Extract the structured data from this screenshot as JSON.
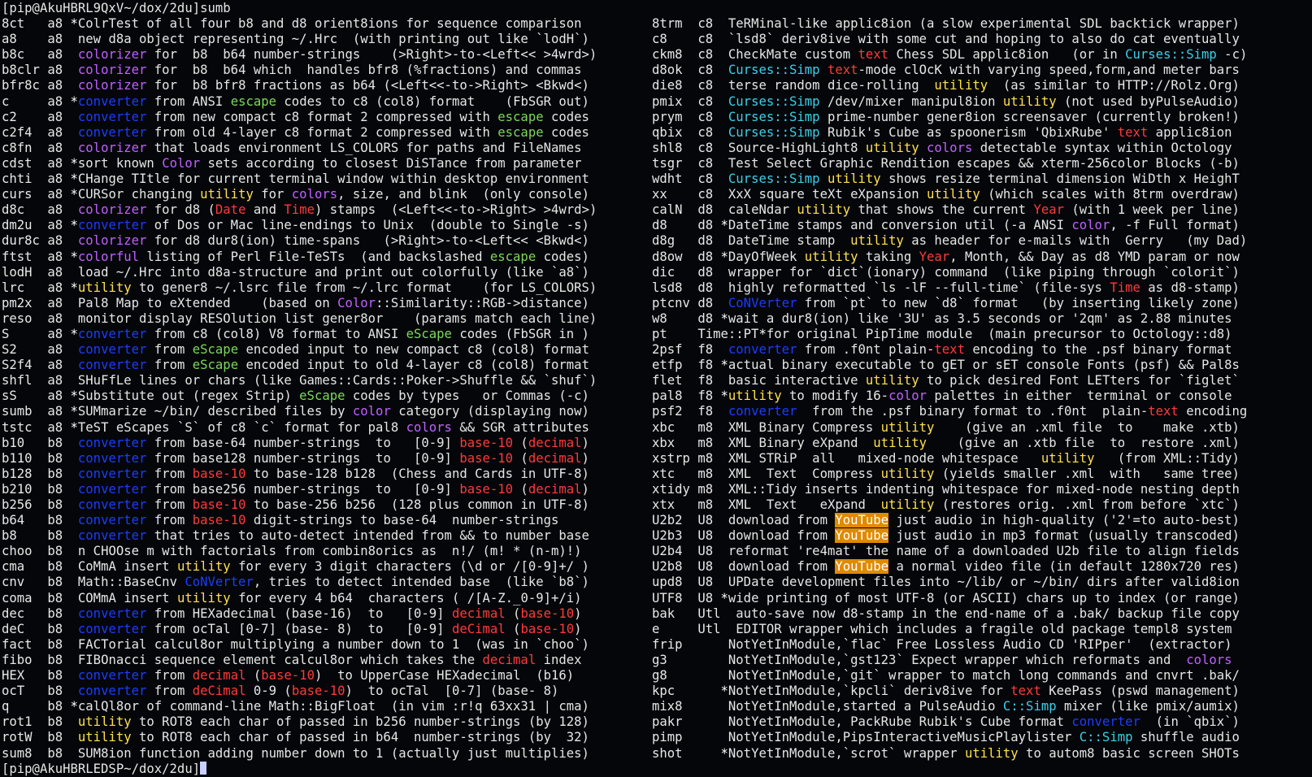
{
  "terminal": {
    "prompt_top": "[pip@AkuHBRL9QxV~/dox/2du]sumb",
    "prompt_bottom": "[pip@AkuHBRLEDSP~/dox/2du]"
  },
  "left_rows": [
    {
      "name": "8ct",
      "cat": "a8",
      "star": "*",
      "desc": "ColrTest of all four b8 and d8 orient8ions for sequence comparison"
    },
    {
      "name": "a8",
      "cat": "a8",
      "star": " ",
      "desc": "new d8a object representing ~/.Hrc  (with printing out like `lodH`)"
    },
    {
      "name": "b8c",
      "cat": "a8",
      "star": " ",
      "desc": "colorizer for  b8  b64 number-strings    (>Right>-to-<Left<< >4wrd>)"
    },
    {
      "name": "b8clr",
      "cat": "a8",
      "star": " ",
      "desc": "colorizer for  b8  b64 which  handles bfr8 (%fractions) and commas"
    },
    {
      "name": "bfr8c",
      "cat": "a8",
      "star": " ",
      "desc": "colorizer for  b8 bfr8 fractions as b64 (<Left<<-to->Right> <Bkwd<)"
    },
    {
      "name": "c",
      "cat": "a8",
      "star": "*",
      "desc": "converter from ANSI escape codes to c8 (col8) format    (FbSGR out)"
    },
    {
      "name": "c2",
      "cat": "a8",
      "star": " ",
      "desc": "converter from new compact c8 format 2 compressed with escape codes"
    },
    {
      "name": "c2f4",
      "cat": "a8",
      "star": " ",
      "desc": "converter from old 4-layer c8 format 2 compressed with escape codes"
    },
    {
      "name": "c8fn",
      "cat": "a8",
      "star": " ",
      "desc": "colorizer that loads environment LS_COLORS for paths and FileNames"
    },
    {
      "name": "cdst",
      "cat": "a8",
      "star": "*",
      "desc": "sort known Color sets according to closest DiSTance from parameter"
    },
    {
      "name": "chti",
      "cat": "a8",
      "star": "*",
      "desc": "CHange TItle for current terminal window within desktop environment"
    },
    {
      "name": "curs",
      "cat": "a8",
      "star": "*",
      "desc": "CURSor changing utility for colors, size, and blink  (only console)"
    },
    {
      "name": "d8c",
      "cat": "a8",
      "star": " ",
      "desc": "colorizer for d8 (Date and Time) stamps  (<Left<<-to->Right> >4wrd>)"
    },
    {
      "name": "dm2u",
      "cat": "a8",
      "star": "*",
      "desc": "converter of Dos or Mac line-endings to Unix  (double to Single -s)"
    },
    {
      "name": "dur8c",
      "cat": "a8",
      "star": " ",
      "desc": "colorizer for d8 dur8(ion) time-spans   (>Right>-to-<Left<< <Bkwd<)"
    },
    {
      "name": "ftst",
      "cat": "a8",
      "star": "*",
      "desc": "colorful listing of Perl File-TeSTs  (and backslashed escape codes)"
    },
    {
      "name": "lodH",
      "cat": "a8",
      "star": " ",
      "desc": "load ~/.Hrc into d8a-structure and print out colorfully (like `a8`)"
    },
    {
      "name": "lrc",
      "cat": "a8",
      "star": "*",
      "desc": "utility to gener8 ~/.lsrc file from ~/.lrc format    (for LS_COLORS)"
    },
    {
      "name": "pm2x",
      "cat": "a8",
      "star": " ",
      "desc": "Pal8 Map to eXtended    (based on Color::Similarity::RGB->distance)"
    },
    {
      "name": "reso",
      "cat": "a8",
      "star": " ",
      "desc": "monitor display RESOlution list gener8or    (params match each line)"
    },
    {
      "name": "S",
      "cat": "a8",
      "star": "*",
      "desc": "converter from c8 (col8) V8 format to ANSI eScape codes (FbSGR in )"
    },
    {
      "name": "S2",
      "cat": "a8",
      "star": " ",
      "desc": "converter from eScape encoded input to new compact c8 (col8) format"
    },
    {
      "name": "S2f4",
      "cat": "a8",
      "star": " ",
      "desc": "converter from eScape encoded input to old 4-layer c8 (col8) format"
    },
    {
      "name": "shfl",
      "cat": "a8",
      "star": " ",
      "desc": "SHuFfLe lines or chars (like Games::Cards::Poker->Shuffle && `shuf`)"
    },
    {
      "name": "sS",
      "cat": "a8",
      "star": "*",
      "desc": "Substitute out (regex Strip) eScape codes by types   or Commas (-c)"
    },
    {
      "name": "sumb",
      "cat": "a8",
      "star": "*",
      "desc": "SUMmarize ~/bin/ described files by color category (displaying now)"
    },
    {
      "name": "tstc",
      "cat": "a8",
      "star": "*",
      "desc": "TeST eScapes `S` of c8 `c` format for pal8 colors && SGR attributes"
    },
    {
      "name": "b10",
      "cat": "b8",
      "star": " ",
      "desc": "converter from base-64 number-strings  to   [0-9] base-10 (decimal)"
    },
    {
      "name": "b110",
      "cat": "b8",
      "star": " ",
      "desc": "converter from base128 number-strings  to   [0-9] base-10 (decimal)"
    },
    {
      "name": "b128",
      "cat": "b8",
      "star": " ",
      "desc": "converter from base-10 to base-128 b128  (Chess and Cards in UTF-8)"
    },
    {
      "name": "b210",
      "cat": "b8",
      "star": " ",
      "desc": "converter from base256 number-strings  to   [0-9] base-10 (decimal)"
    },
    {
      "name": "b256",
      "cat": "b8",
      "star": " ",
      "desc": "converter from base-10 to base-256 b256  (128 plus common in UTF-8)"
    },
    {
      "name": "b64",
      "cat": "b8",
      "star": " ",
      "desc": "converter from base-10 digit-strings to base-64  number-strings"
    },
    {
      "name": "b8",
      "cat": "b8",
      "star": " ",
      "desc": "converter that tries to auto-detect intended from && to number base"
    },
    {
      "name": "choo",
      "cat": "b8",
      "star": " ",
      "desc": "n CHOOse m with factorials from combin8orics as  n!/ (m! * (n-m)!)"
    },
    {
      "name": "cma",
      "cat": "b8",
      "star": " ",
      "desc": "CoMmA insert utility for every 3 digit characters (\\d or /[0-9]+/ )"
    },
    {
      "name": "cnv",
      "cat": "b8",
      "star": " ",
      "desc": "Math::BaseCnv CoNVerter, tries to detect intended base  (like `b8`)"
    },
    {
      "name": "coma",
      "cat": "b8",
      "star": " ",
      "desc": "COMmA insert utility for every 4 b64  characters ( /[A-Z._0-9]+/i)"
    },
    {
      "name": "dec",
      "cat": "b8",
      "star": " ",
      "desc": "converter from HEXadecimal (base-16)  to   [0-9] decimal (base-10)"
    },
    {
      "name": "deC",
      "cat": "b8",
      "star": " ",
      "desc": "converter from ocTal [0-7] (base- 8)  to   [0-9] deCimal (base-10)"
    },
    {
      "name": "fact",
      "cat": "b8",
      "star": " ",
      "desc": "FACTorial calcul8or multiplying a number down to 1  (was in `choo`)"
    },
    {
      "name": "fibo",
      "cat": "b8",
      "star": " ",
      "desc": "FIBOnacci sequence element calcul8or which takes the decimal index"
    },
    {
      "name": "HEX",
      "cat": "b8",
      "star": " ",
      "desc": "converter from decimal (base-10)  to UpperCase HEXadecimal  (b16)"
    },
    {
      "name": "ocT",
      "cat": "b8",
      "star": " ",
      "desc": "converter from deCimal 0-9 (base-10)  to ocTal  [0-7] (base- 8)"
    },
    {
      "name": "q",
      "cat": "b8",
      "star": "*",
      "desc": "calQl8or of command-line Math::BigFloat  (in vim :r!q 63xx31 | cma)"
    },
    {
      "name": "rot1",
      "cat": "b8",
      "star": " ",
      "desc": "utility to ROT8 each char of passed in b256 number-strings (by 128)"
    },
    {
      "name": "rotW",
      "cat": "b8",
      "star": " ",
      "desc": "utility to ROT8 each char of passed in b64  number-strings (by  32)"
    },
    {
      "name": "sum8",
      "cat": "b8",
      "star": " ",
      "desc": "SUM8ion function adding number down to 1 (actually just multiplies)"
    }
  ],
  "right_rows": [
    {
      "name": "8trm",
      "cat": "c8",
      "star": " ",
      "desc": "TeRMinal-like applic8ion (a slow experimental SDL backtick wrapper)"
    },
    {
      "name": "c8",
      "cat": "c8",
      "star": " ",
      "desc": "`lsd8` deriv8ive with some cut and hoping to also do cat eventually"
    },
    {
      "name": "ckm8",
      "cat": "c8",
      "star": " ",
      "desc": "CheckMate custom text Chess SDL applic8ion   (or in Curses::Simp -c)"
    },
    {
      "name": "d8ok",
      "cat": "c8",
      "star": " ",
      "desc": "Curses::Simp text-mode clOcK with varying speed,form,and meter bars"
    },
    {
      "name": "die8",
      "cat": "c8",
      "star": " ",
      "desc": "terse random dice-rolling  utility  (as similar to HTTP://Rolz.Org)"
    },
    {
      "name": "pmix",
      "cat": "c8",
      "star": " ",
      "desc": "Curses::Simp /dev/mixer manipul8ion utility (not used byPulseAudio)"
    },
    {
      "name": "prym",
      "cat": "c8",
      "star": " ",
      "desc": "Curses::Simp prime-number gener8ion screensaver (currently broken!)"
    },
    {
      "name": "qbix",
      "cat": "c8",
      "star": " ",
      "desc": "Curses::Simp Rubik's Cube as spoonerism 'QbixRube' text applic8ion"
    },
    {
      "name": "shl8",
      "cat": "c8",
      "star": " ",
      "desc": "Source-HighLight8 utility colors detectable syntax within Octology"
    },
    {
      "name": "tsgr",
      "cat": "c8",
      "star": " ",
      "desc": "Test Select Graphic Rendition escapes && xterm-256color Blocks (-b)"
    },
    {
      "name": "wdht",
      "cat": "c8",
      "star": " ",
      "desc": "Curses::Simp utility shows resize terminal dimension WiDth x HeighT"
    },
    {
      "name": "xx",
      "cat": "c8",
      "star": " ",
      "desc": "XxX square teXt eXpansion utility (which scales with 8trm overdraw)"
    },
    {
      "name": "calN",
      "cat": "d8",
      "star": " ",
      "desc": "caleNdar utility that shows the current Year (with 1 week per line)"
    },
    {
      "name": "d8",
      "cat": "d8",
      "star": "*",
      "desc": "DateTime stamps and conversion util (-a ANSI color, -f Full format)"
    },
    {
      "name": "d8g",
      "cat": "d8",
      "star": " ",
      "desc": "DateTime stamp  utility as header for e-mails with  Gerry   (my Dad)"
    },
    {
      "name": "d8ow",
      "cat": "d8",
      "star": "*",
      "desc": "DayOfWeek utility taking Year, Month, && Day as d8 YMD param or now"
    },
    {
      "name": "dic",
      "cat": "d8",
      "star": " ",
      "desc": "wrapper for `dict`(ionary) command  (like piping through `colorit`)"
    },
    {
      "name": "lsd8",
      "cat": "d8",
      "star": " ",
      "desc": "highly reformatted `ls -lF --full-time` (file-sys Time as d8-stamp)"
    },
    {
      "name": "ptcnv",
      "cat": "d8",
      "star": " ",
      "desc": "CoNVerter from `pt` to new `d8` format   (by inserting likely zone)"
    },
    {
      "name": "w8",
      "cat": "d8",
      "star": "*",
      "desc": "wait a dur8(ion) like '3U' as 3.5 seconds or '2qm' as 2.88 minutes"
    },
    {
      "name": "pt",
      "cat": "Time::PT",
      "star": "*",
      "desc": "for original PipTime module  (main precursor to Octology::d8)"
    },
    {
      "name": "2psf",
      "cat": "f8",
      "star": " ",
      "desc": "converter from .f0nt plain-text encoding to the .psf binary format"
    },
    {
      "name": "etfp",
      "cat": "f8",
      "star": "*",
      "desc": "actual binary executable to gET or sET console Fonts (psf) && Pal8s"
    },
    {
      "name": "flet",
      "cat": "f8",
      "star": " ",
      "desc": "basic interactive utility to pick desired Font LETters for `figlet`"
    },
    {
      "name": "pal8",
      "cat": "f8",
      "star": "*",
      "desc": "utility to modify 16-color palettes in either  terminal or console"
    },
    {
      "name": "psf2",
      "cat": "f8",
      "star": " ",
      "desc": "converter  from the .psf binary format to .f0nt  plain-text encoding"
    },
    {
      "name": "xbc",
      "cat": "m8",
      "star": " ",
      "desc": "XML Binary Compress utility    (give an .xml file  to    make .xtb)"
    },
    {
      "name": "xbx",
      "cat": "m8",
      "star": " ",
      "desc": "XML Binary eXpand  utility    (give an .xtb file  to  restore .xml)"
    },
    {
      "name": "xstrp",
      "cat": "m8",
      "star": " ",
      "desc": "XML STRiP  all   mixed-node whitespace   utility   (from XML::Tidy)"
    },
    {
      "name": "xtc",
      "cat": "m8",
      "star": " ",
      "desc": "XML  Text  Compress utility (yields smaller .xml  with   same tree)"
    },
    {
      "name": "xtidy",
      "cat": "m8",
      "star": " ",
      "desc": "XML::Tidy inserts indenting whitespace for mixed-node nesting depth"
    },
    {
      "name": "xtx",
      "cat": "m8",
      "star": " ",
      "desc": "XML  Text   eXpand  utility (restores orig. .xml from before `xtc`)"
    },
    {
      "name": "U2b2",
      "cat": "U8",
      "star": " ",
      "desc": "download from YouTube just audio in high-quality ('2'=to auto-best)"
    },
    {
      "name": "U2b3",
      "cat": "U8",
      "star": " ",
      "desc": "download from YouTube just audio in mp3 format (usually transcoded)"
    },
    {
      "name": "U2b4",
      "cat": "U8",
      "star": " ",
      "desc": "reformat 're4mat' the name of a downloaded U2b file to align fields"
    },
    {
      "name": "U2b8",
      "cat": "U8",
      "star": " ",
      "desc": "download from YouTube a normal video file (in default 1280x720 res)"
    },
    {
      "name": "upd8",
      "cat": "U8",
      "star": " ",
      "desc": "UPDate development files into ~/lib/ or ~/bin/ dirs after valid8ion"
    },
    {
      "name": "UTF8",
      "cat": "U8",
      "star": "*",
      "desc": "wide printing of most UTF-8 (or ASCII) chars up to index (or range)"
    },
    {
      "name": "bak",
      "cat": "Utl",
      "star": " ",
      "desc": " auto-save now d8-stamp in the end-name of a .bak/ backup file copy"
    },
    {
      "name": "e",
      "cat": "Utl",
      "star": " ",
      "desc": " EDITOR wrapper which includes a fragile old package templ8 system"
    },
    {
      "name": "frip",
      "cat": "",
      "star": " ",
      "desc": "NotYetInModule,`flac` Free Lossless Audio CD 'RIPper'  (extractor)"
    },
    {
      "name": "g3",
      "cat": "",
      "star": " ",
      "desc": "NotYetInModule,`gst123` Expect wrapper which reformats and  colors"
    },
    {
      "name": "g8",
      "cat": "",
      "star": " ",
      "desc": "NotYetInModule,`git` wrapper to match long commands and cnvrt .bak/"
    },
    {
      "name": "kpc",
      "cat": "",
      "star": "*",
      "desc": "NotYetInModule,`kpcli` deriv8ive for text KeePass (pswd management)"
    },
    {
      "name": "mix8",
      "cat": "",
      "star": " ",
      "desc": "NotYetInModule,started a PulseAudio C::Simp mixer (like pmix/aumix)"
    },
    {
      "name": "pakr",
      "cat": "",
      "star": " ",
      "desc": "NotYetInModule, PackRube Rubik's Cube format converter  (in `qbix`)"
    },
    {
      "name": "pimp",
      "cat": "",
      "star": " ",
      "desc": "NotYetInModule,PipsInteractiveMusicPlaylister C::Simp shuffle audio"
    },
    {
      "name": "shot",
      "cat": "",
      "star": "*",
      "desc": "NotYetInModule,`scrot` wrapper utility to autom8 basic screen SHOTs"
    }
  ]
}
